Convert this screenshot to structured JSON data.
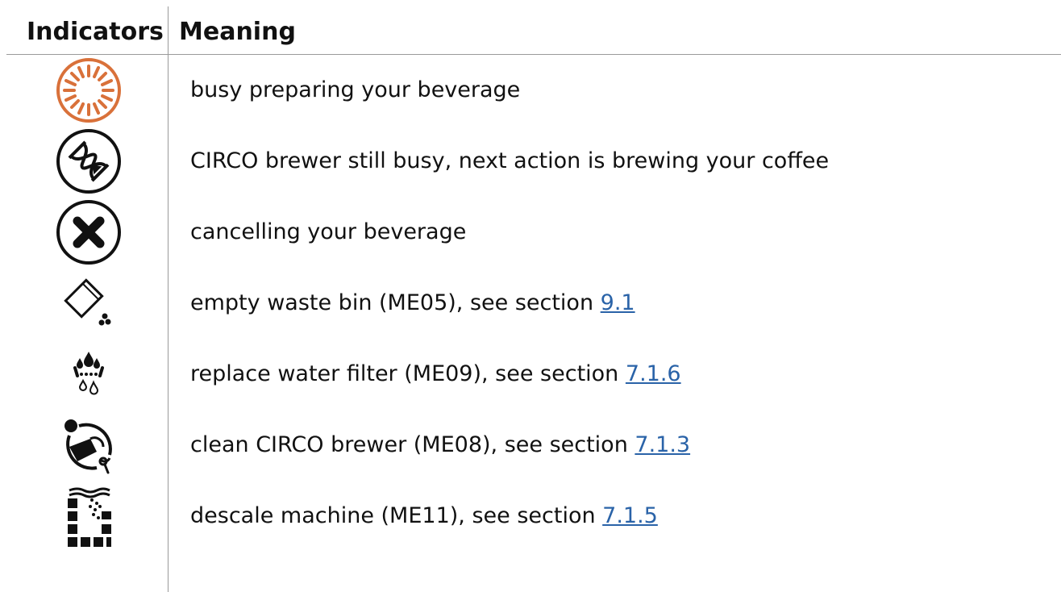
{
  "header": {
    "indicators_label": "Indicators",
    "meaning_label": "Meaning"
  },
  "colors": {
    "busy_icon": "#d9713a",
    "link": "#2a63a8"
  },
  "rows": [
    {
      "icon": "busy-spinner-icon",
      "text": "busy preparing your beverage"
    },
    {
      "icon": "hourglass-icon",
      "text": "CIRCO brewer still busy, next action is brewing your coffee"
    },
    {
      "icon": "cancel-x-icon",
      "text": "cancelling your beverage"
    },
    {
      "icon": "waste-bin-icon",
      "text": "empty waste bin (ME05), see section ",
      "link": "9.1"
    },
    {
      "icon": "water-filter-icon",
      "text": "replace water filter (ME09), see section ",
      "link": "7.1.6"
    },
    {
      "icon": "brewer-clean-icon",
      "text": "clean CIRCO brewer (ME08), see section ",
      "link": "7.1.3"
    },
    {
      "icon": "descale-icon",
      "text": "descale machine (ME11), see section ",
      "link": "7.1.5"
    }
  ]
}
